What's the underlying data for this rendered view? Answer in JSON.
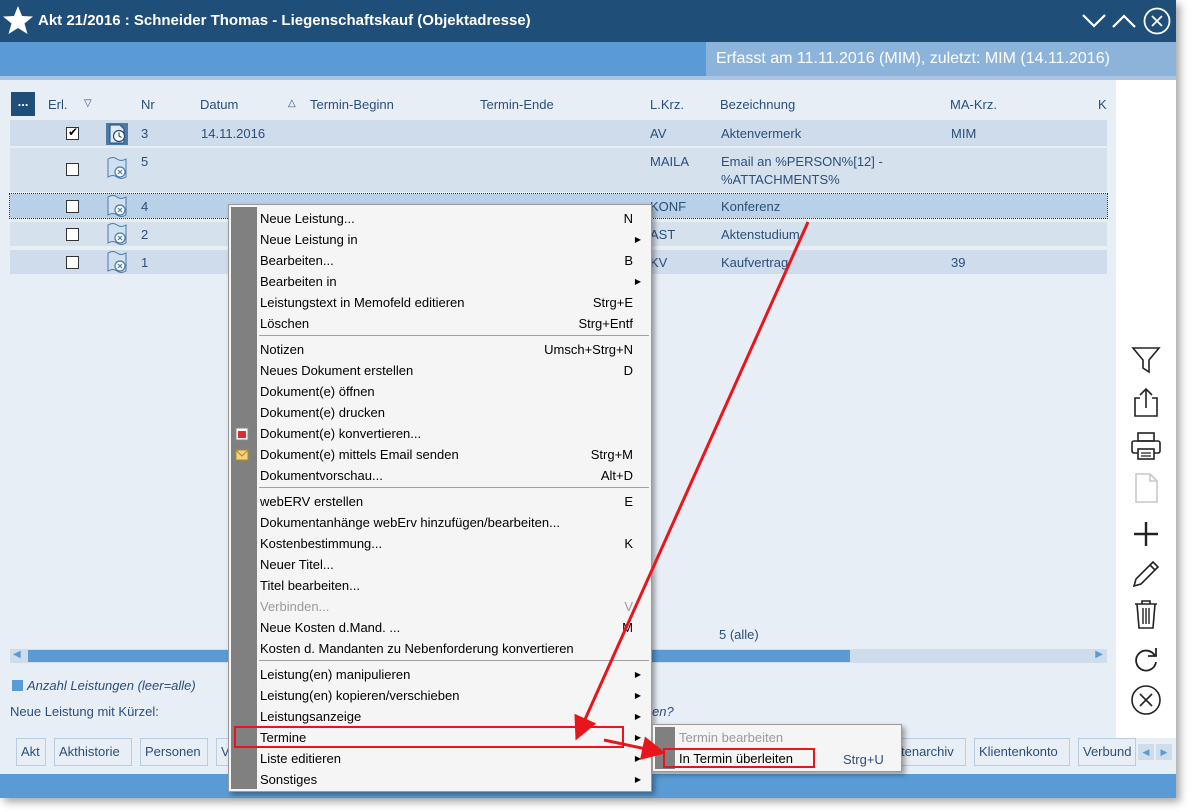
{
  "window": {
    "title": "Akt 21/2016 : Schneider Thomas - Liegenschaftskauf (Objektadresse)",
    "info": "Erfasst am 11.11.2016 (MIM), zuletzt: MIM (14.11.2016)"
  },
  "table": {
    "dots_label": "...",
    "headers": {
      "erl": "Erl.",
      "nr": "Nr",
      "datum": "Datum",
      "termin_beginn": "Termin-Beginn",
      "termin_ende": "Termin-Ende",
      "lkrz": "L.Krz.",
      "bezeichnung": "Bezeichnung",
      "makrz": "MA-Krz.",
      "k": "K"
    },
    "rows": [
      {
        "checked": true,
        "nr": "3",
        "datum": "14.11.2016",
        "lkrz": "AV",
        "bezeichnung": "Aktenvermerk",
        "bezeichnung2": "",
        "makrz": "MIM",
        "icon": "clock-document-icon"
      },
      {
        "checked": false,
        "nr": "5",
        "datum": "",
        "lkrz": "MAILA",
        "bezeichnung": "Email an %PERSON%[12] -",
        "bezeichnung2": "%ATTACHMENTS%",
        "makrz": "",
        "icon": "document-x-icon"
      },
      {
        "checked": false,
        "nr": "4",
        "datum": "",
        "lkrz": "KONF",
        "bezeichnung": "Konferenz",
        "bezeichnung2": "",
        "makrz": "",
        "icon": "document-x-icon"
      },
      {
        "checked": false,
        "nr": "2",
        "datum": "",
        "lkrz": "AST",
        "bezeichnung": "Aktenstudium",
        "bezeichnung2": "",
        "makrz": "",
        "icon": "document-x-icon"
      },
      {
        "checked": false,
        "nr": "1",
        "datum": "",
        "lkrz": "KV",
        "bezeichnung": "Kaufvertrag",
        "bezeichnung2": "",
        "makrz": "39",
        "icon": "document-x-icon"
      }
    ],
    "count": "5 (alle)"
  },
  "footer": {
    "count_label": "Anzahl Leistungen (leer=alle)",
    "new_label": "Neue Leistung mit Kürzel:",
    "fragment": "en?"
  },
  "tabs": [
    "Akt",
    "Akthistorie",
    "Personen",
    "V",
    "tenarchiv",
    "Klientenkonto",
    "Verbund"
  ],
  "context_menu": {
    "items": [
      {
        "label": "Neue Leistung...",
        "shortcut": "N",
        "submenu": false,
        "disabled": false
      },
      {
        "label": "Neue Leistung in",
        "shortcut": "",
        "submenu": true,
        "disabled": false
      },
      {
        "label": "Bearbeiten...",
        "shortcut": "B",
        "submenu": false,
        "disabled": false
      },
      {
        "label": "Bearbeiten in",
        "shortcut": "",
        "submenu": true,
        "disabled": false
      },
      {
        "label": "Leistungstext in Memofeld editieren",
        "shortcut": "Strg+E",
        "submenu": false,
        "disabled": false
      },
      {
        "label": "Löschen",
        "shortcut": "Strg+Entf",
        "submenu": false,
        "disabled": false
      },
      {
        "label": "Notizen",
        "shortcut": "Umsch+Strg+N",
        "submenu": false,
        "disabled": false
      },
      {
        "label": "Neues Dokument erstellen",
        "shortcut": "D",
        "submenu": false,
        "disabled": false
      },
      {
        "label": "Dokument(e) öffnen",
        "shortcut": "",
        "submenu": false,
        "disabled": false
      },
      {
        "label": "Dokument(e) drucken",
        "shortcut": "",
        "submenu": false,
        "disabled": false
      },
      {
        "label": "Dokument(e) konvertieren...",
        "shortcut": "",
        "submenu": false,
        "disabled": false
      },
      {
        "label": "Dokument(e) mittels Email senden",
        "shortcut": "Strg+M",
        "submenu": false,
        "disabled": false
      },
      {
        "label": "Dokumentvorschau...",
        "shortcut": "Alt+D",
        "submenu": false,
        "disabled": false
      },
      {
        "label": "webERV erstellen",
        "shortcut": "E",
        "submenu": false,
        "disabled": false
      },
      {
        "label": "Dokumentanhänge webErv hinzufügen/bearbeiten...",
        "shortcut": "",
        "submenu": false,
        "disabled": false
      },
      {
        "label": "Kostenbestimmung...",
        "shortcut": "K",
        "submenu": false,
        "disabled": false
      },
      {
        "label": "Neuer Titel...",
        "shortcut": "",
        "submenu": false,
        "disabled": false
      },
      {
        "label": "Titel bearbeiten...",
        "shortcut": "",
        "submenu": false,
        "disabled": false
      },
      {
        "label": "Verbinden...",
        "shortcut": "V",
        "submenu": false,
        "disabled": true
      },
      {
        "label": "Neue Kosten d.Mand. ...",
        "shortcut": "M",
        "submenu": false,
        "disabled": false
      },
      {
        "label": "Kosten d. Mandanten zu Nebenforderung konvertieren",
        "shortcut": "",
        "submenu": false,
        "disabled": false
      },
      {
        "label": "Leistung(en) manipulieren",
        "shortcut": "",
        "submenu": true,
        "disabled": false
      },
      {
        "label": "Leistung(en) kopieren/verschieben",
        "shortcut": "",
        "submenu": true,
        "disabled": false
      },
      {
        "label": "Leistungsanzeige",
        "shortcut": "",
        "submenu": true,
        "disabled": false
      },
      {
        "label": "Termine",
        "shortcut": "",
        "submenu": true,
        "disabled": false
      },
      {
        "label": "Liste editieren",
        "shortcut": "",
        "submenu": true,
        "disabled": false
      },
      {
        "label": "Sonstiges",
        "shortcut": "",
        "submenu": true,
        "disabled": false
      }
    ]
  },
  "submenu": {
    "item1": "Termin bearbeiten",
    "item2": "In Termin überleiten",
    "item2_shortcut": "Strg+U"
  },
  "sidebar_icons": [
    "filter-icon",
    "export-icon",
    "printer-icon",
    "document-icon",
    "plus-icon",
    "pencil-icon",
    "trash-icon",
    "refresh-icon",
    "close-circle-icon"
  ],
  "colors": {
    "title_bar": "#1f4e79",
    "accent": "#5b9bd5",
    "annotation": "#e8161c"
  }
}
